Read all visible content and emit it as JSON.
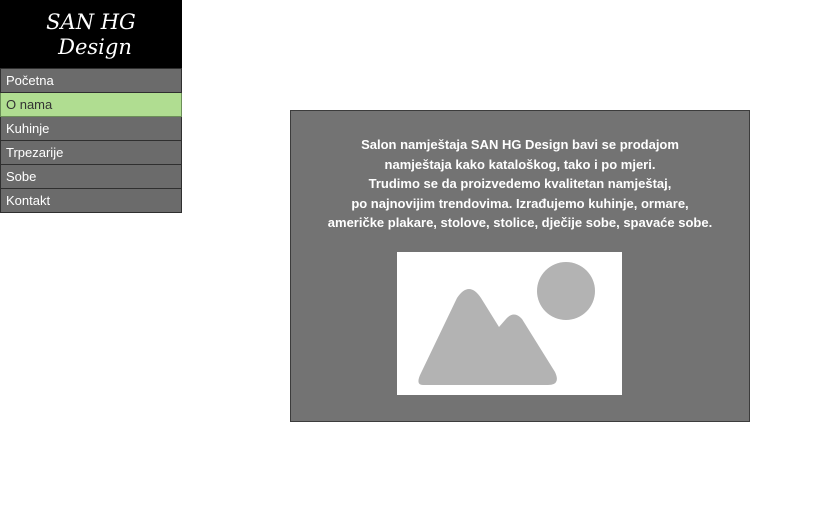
{
  "logo": {
    "line1": "SAN HG",
    "line2": "Design"
  },
  "nav": {
    "items": [
      {
        "label": "Početna",
        "active": false
      },
      {
        "label": "O nama",
        "active": true
      },
      {
        "label": "Kuhinje",
        "active": false
      },
      {
        "label": "Trpezarije",
        "active": false
      },
      {
        "label": "Sobe",
        "active": false
      },
      {
        "label": "Kontakt",
        "active": false
      }
    ]
  },
  "content": {
    "lines": [
      "Salon namještaja SAN HG Design bavi se prodajom",
      "namještaja kako kataloškog, tako i po mjeri.",
      "Trudimo se da proizvedemo kvalitetan namještaj,",
      "po najnovijim trendovima. Izrađujemo kuhinje, ormare,",
      "američke plakare, stolove, stolice, dječije sobe, spavaće sobe."
    ],
    "image_icon": "image-placeholder-icon"
  },
  "colors": {
    "logo_bg": "#000000",
    "nav_bg": "#6b6b6b",
    "nav_active_bg": "#b0dd91",
    "content_bg": "#737373",
    "placeholder_shape": "#b3b3b3"
  }
}
